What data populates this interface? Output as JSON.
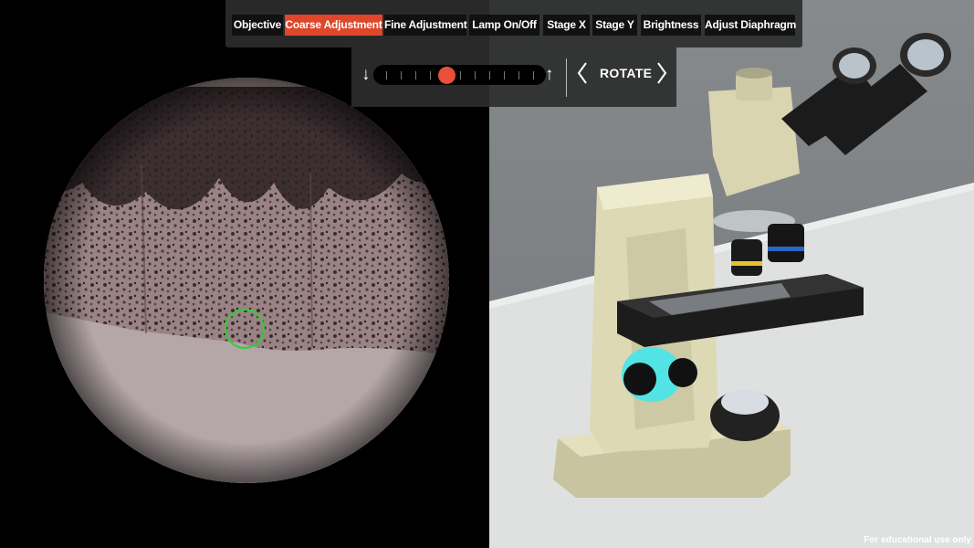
{
  "toolbar": {
    "tabs": [
      {
        "label": "Objective"
      },
      {
        "label": "Coarse Adjustment",
        "active": true
      },
      {
        "label": "Fine Adjustment"
      },
      {
        "label": "Lamp On/Off"
      },
      {
        "label": "Stage X"
      },
      {
        "label": "Stage Y"
      },
      {
        "label": "Brightness"
      },
      {
        "label": "Adjust Diaphragm"
      }
    ],
    "active_color": "#e0462a"
  },
  "adjustment_slider": {
    "value_fraction": 0.42,
    "down_icon": "arrow-down-icon",
    "up_icon": "arrow-up-icon"
  },
  "rotate": {
    "label": "ROTATE",
    "left_icon": "chevron-left-icon",
    "right_icon": "chevron-right-icon"
  },
  "eyepiece": {
    "marker_icon": "target-circle-icon",
    "marker_color": "#2fd12f"
  },
  "footer": {
    "note": "For educational use only"
  }
}
